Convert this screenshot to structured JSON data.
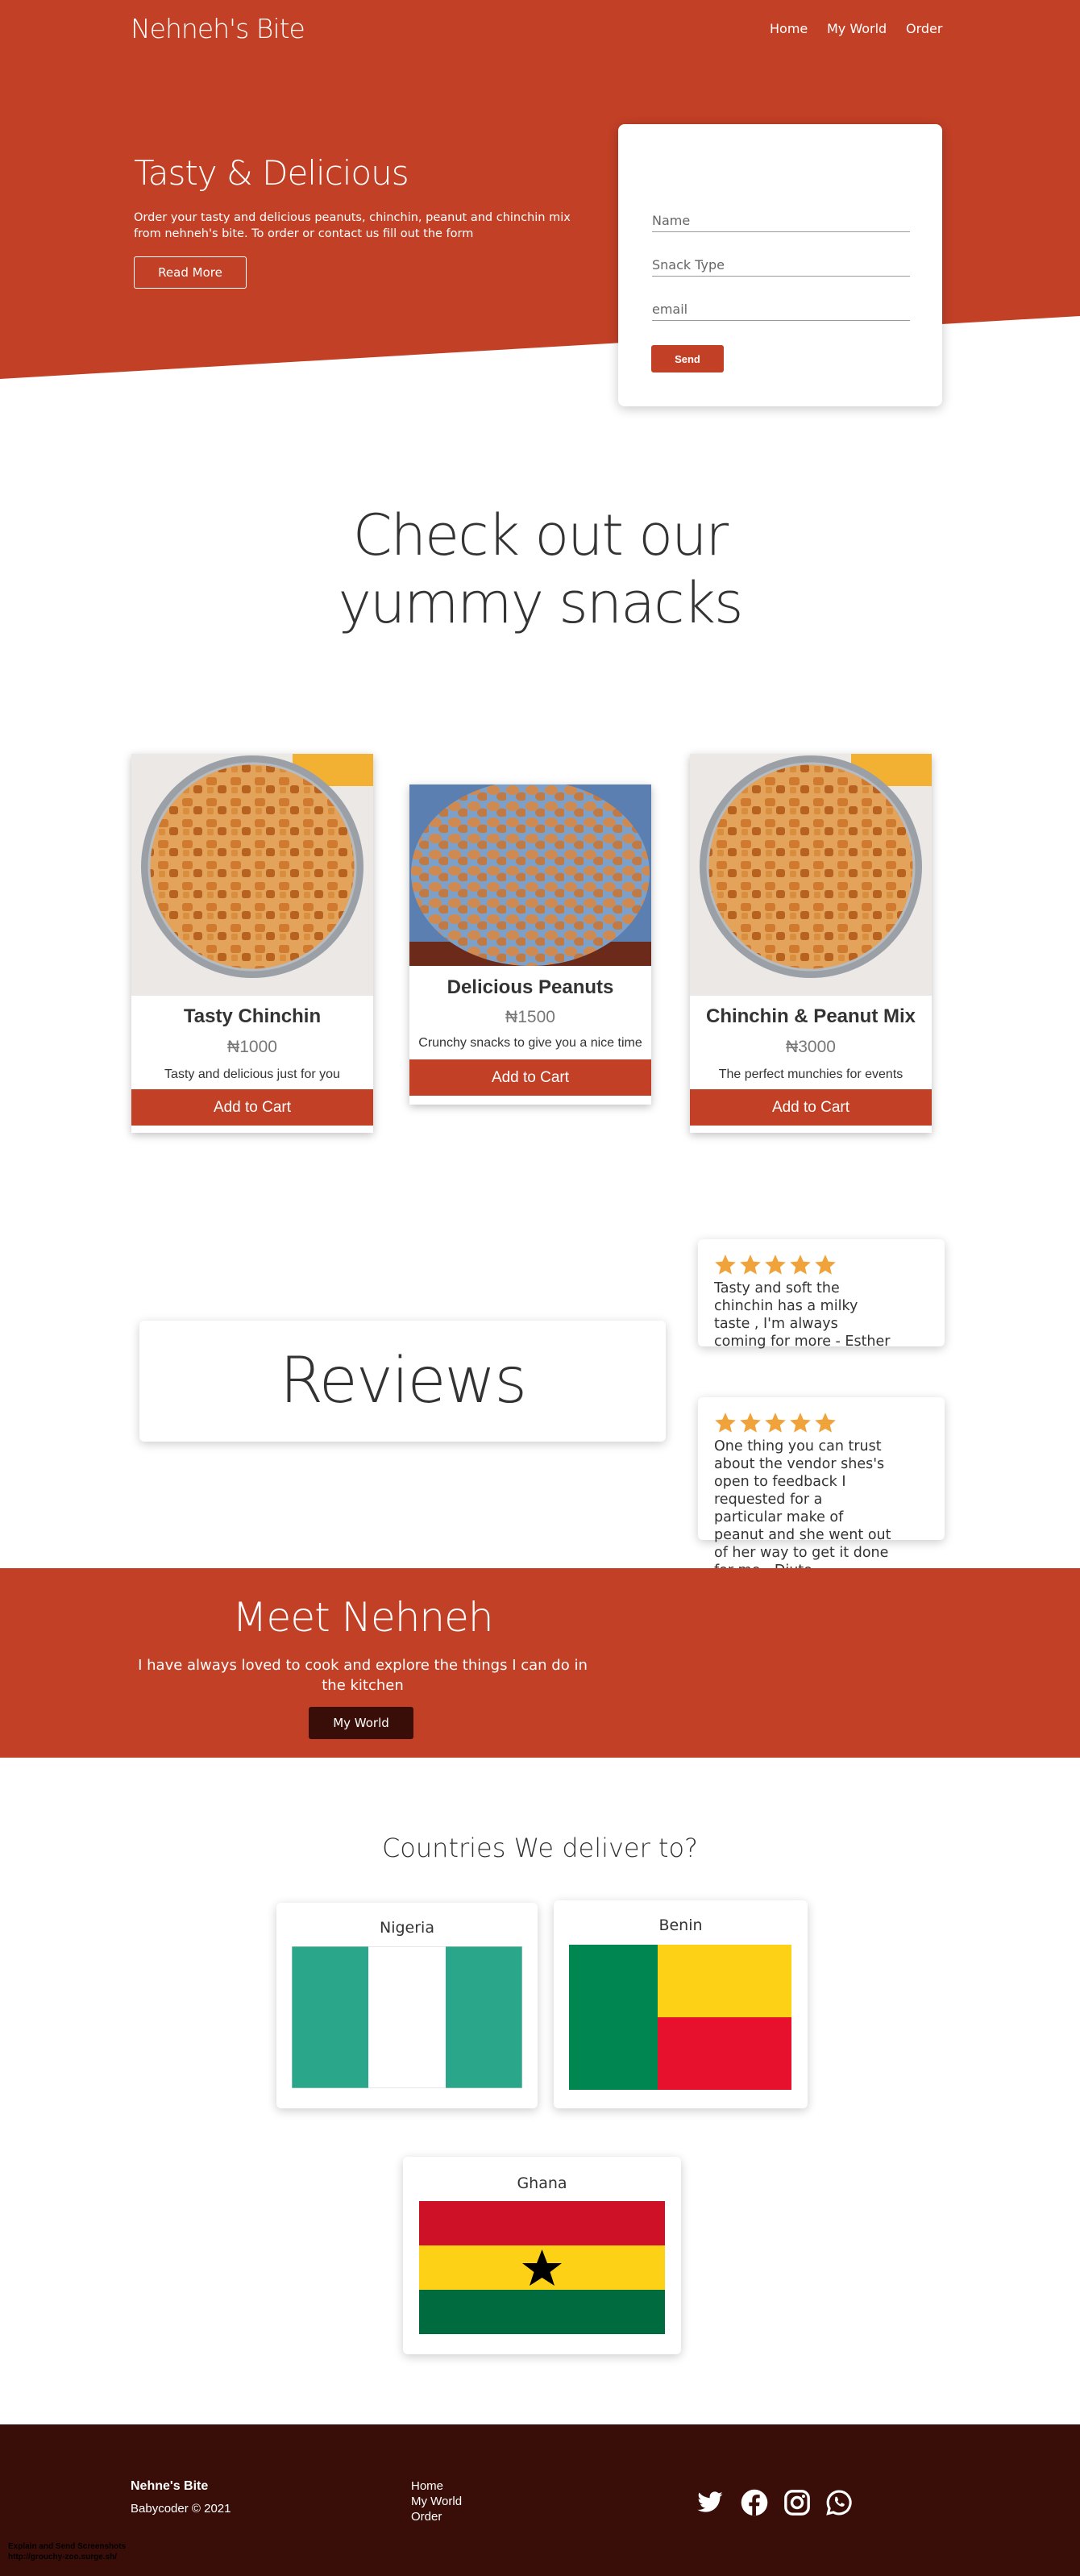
{
  "colors": {
    "brand": "#c24026",
    "dark": "#3a0e08",
    "star": "#f0a33a"
  },
  "header": {
    "brand": "Nehneh's Bite",
    "nav": [
      "Home",
      "My World",
      "Order"
    ]
  },
  "hero": {
    "title": "Tasty & Delicious",
    "description": "Order your tasty and delicious peanuts, chinchin, peanut and chinchin mix from nehneh's bite. To order or contact us fill out the form",
    "button": "Read More"
  },
  "order_form": {
    "name_placeholder": "Name",
    "snack_placeholder": "Snack Type",
    "email_placeholder": "email",
    "send_label": "Send"
  },
  "snacks": {
    "heading_line1": "Check out our",
    "heading_line2": "yummy snacks",
    "items": [
      {
        "title": "Tasty Chinchin",
        "price": "₦1000",
        "description": "Tasty and delicious just for you",
        "button": "Add to Cart",
        "image": "chinchin-image"
      },
      {
        "title": "Delicious Peanuts",
        "price": "₦1500",
        "description": "Crunchy snacks to give you a nice time",
        "button": "Add to Cart",
        "image": "peanuts-image"
      },
      {
        "title": "Chinchin & Peanut Mix",
        "price": "₦3000",
        "description": "The perfect munchies for events",
        "button": "Add to Cart",
        "image": "chinchin-image"
      }
    ]
  },
  "reviews": {
    "heading": "Reviews",
    "items": [
      {
        "rating": 5,
        "text": "Tasty and soft the chinchin has a milky taste , I'm always coming for more - Esther"
      },
      {
        "rating": 5,
        "text": "One thing you can trust about the vendor shes's open to feedback I requested for a particular make of peanut and she went out of her way to get it done for me - Diuto"
      }
    ]
  },
  "meet": {
    "title": "Meet Nehneh",
    "text": "I have always loved to cook and explore the things I can do in the kitchen",
    "button": "My World"
  },
  "countries": {
    "heading": "Countries We deliver to?",
    "items": [
      {
        "name": "Nigeria",
        "flag": "nigeria-flag"
      },
      {
        "name": "Benin",
        "flag": "benin-flag"
      },
      {
        "name": "Ghana",
        "flag": "ghana-flag"
      }
    ]
  },
  "footer": {
    "brand": "Nehne's Bite",
    "copyright": "Babycoder © 2021",
    "links": [
      "Home",
      "My World",
      "Order"
    ],
    "social": [
      "twitter-icon",
      "facebook-icon",
      "instagram-icon",
      "whatsapp-icon"
    ]
  },
  "watermark": {
    "line1": "Explain and Send Screenshots",
    "line2": "http://grouchy-zoo.surge.sh/"
  }
}
